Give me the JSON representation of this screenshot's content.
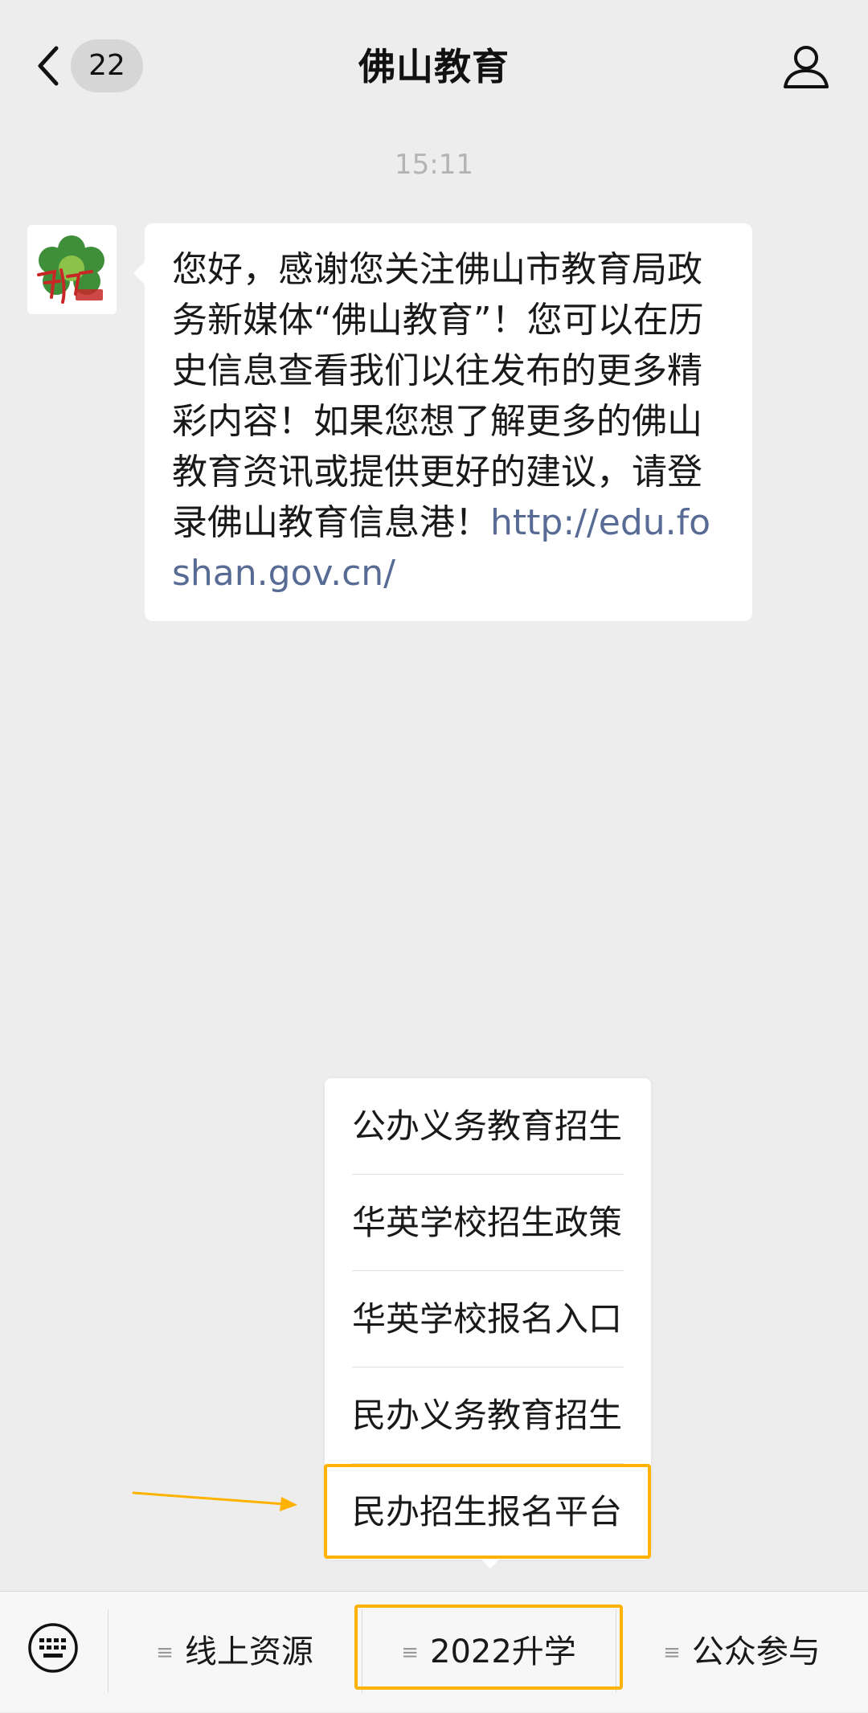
{
  "header": {
    "title": "佛山教育",
    "unread_count": "22"
  },
  "chat": {
    "timestamp": "15:11",
    "message": {
      "text": "您好，感谢您关注佛山市教育局政务新媒体“佛山教育”！您可以在历史信息查看我们以往发布的更多精彩内容！如果您想了解更多的佛山教育资讯或提供更好的建议，请登录佛山教育信息港！",
      "link": "http://edu.foshan.gov.cn/"
    }
  },
  "submenu": {
    "items": [
      {
        "label": "公办义务教育招生"
      },
      {
        "label": "华英学校招生政策"
      },
      {
        "label": "华英学校报名入口"
      },
      {
        "label": "民办义务教育招生"
      },
      {
        "label": "民办招生报名平台"
      }
    ]
  },
  "bottom_menu": {
    "tabs": [
      {
        "label": "线上资源"
      },
      {
        "label": "2022升学"
      },
      {
        "label": "公众参与"
      }
    ]
  },
  "colors": {
    "highlight": "#ffb300",
    "link": "#576b95",
    "background": "#ededed"
  }
}
